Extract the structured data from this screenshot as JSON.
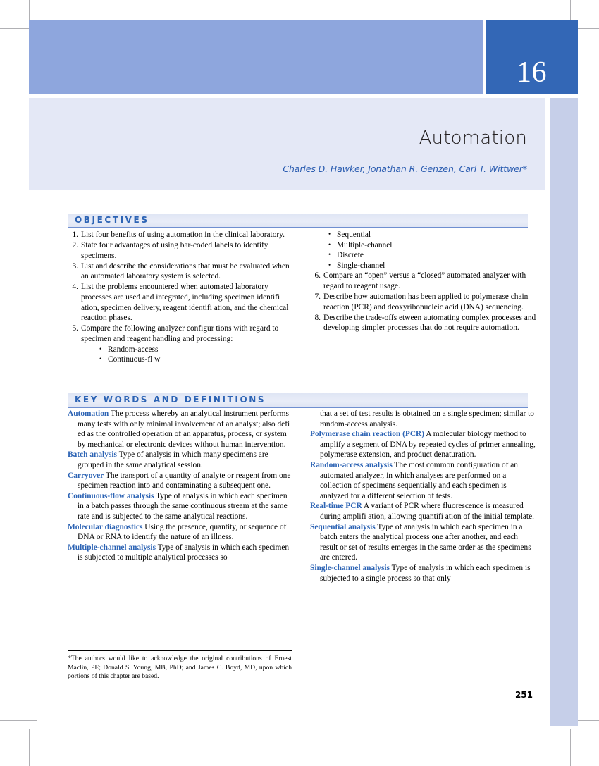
{
  "chapter": {
    "number": "16",
    "title": "Automation",
    "authors": "Charles D. Hawker, Jonathan R. Genzen, Carl T. Wittwer*"
  },
  "objectives": {
    "heading": "OBJECTIVES",
    "items_left": [
      {
        "num": "1.",
        "text": "List four benefits of using automation in the clinical laboratory."
      },
      {
        "num": "2.",
        "text": "State four advantages of using bar-coded labels to identify specimens."
      },
      {
        "num": "3.",
        "text": "List and describe the considerations that must be evaluated when an automated laboratory system is selected."
      },
      {
        "num": "4.",
        "text": "List the problems encountered when automated laboratory processes are used and integrated, including specimen identifi ation, specimen delivery, reagent identifi ation, and the chemical reaction phases."
      },
      {
        "num": "5.",
        "text": "Compare the following analyzer configur tions with regard to specimen and reagent handling and processing:"
      }
    ],
    "item5_bullets_left": [
      "Random-access",
      "Continuous-fl w"
    ],
    "item5_bullets_right": [
      "Sequential",
      "Multiple-channel",
      "Discrete",
      "Single-channel"
    ],
    "items_right": [
      {
        "num": "6.",
        "text": "Compare an “open” versus a “closed” automated analyzer with regard to reagent usage."
      },
      {
        "num": "7.",
        "text": "Describe how automation has been applied to polymerase chain reaction (PCR) and deoxyribonucleic acid (DNA) sequencing."
      },
      {
        "num": "8.",
        "text": "Describe the trade-offs  etween automating complex processes and developing simpler processes that do not require automation."
      }
    ]
  },
  "keywords": {
    "heading": "KEY WORDS AND DEFINITIONS",
    "entries_left": [
      {
        "term": "Automation",
        "definition": "The process whereby an analytical instrument performs many tests with only minimal involvement of an analyst; also defi ed as the controlled operation of an apparatus, process, or system by mechanical or electronic devices without human intervention."
      },
      {
        "term": "Batch analysis",
        "definition": "Type of analysis in which many specimens are grouped in the same analytical session."
      },
      {
        "term": "Carryover",
        "definition": "The transport of a quantity of analyte or reagent from one specimen reaction into and contaminating a subsequent one."
      },
      {
        "term": "Continuous-flow analysis",
        "definition": "Type of analysis in which each specimen in a batch passes through the same continuous stream at the same rate and is subjected to the same analytical reactions."
      },
      {
        "term": "Molecular diagnostics",
        "definition": "Using the presence, quantity, or sequence of DNA or RNA to identify the nature of an illness."
      },
      {
        "term": "Multiple-channel analysis",
        "definition": "Type of analysis in which each specimen is subjected to multiple analytical processes so"
      }
    ],
    "continuation_right": "that a set of test results is obtained on a single specimen; similar to random-access analysis.",
    "entries_right": [
      {
        "term": "Polymerase chain reaction (PCR)",
        "definition": "A molecular biology method to amplify a segment of DNA by repeated cycles of primer annealing, polymerase extension, and product denaturation."
      },
      {
        "term": "Random-access analysis",
        "definition": "The most common configuration of an automated analyzer, in which analyses are performed on a collection of specimens sequentially and each specimen is analyzed for a different selection of tests."
      },
      {
        "term": "Real-time PCR",
        "definition": "A variant of PCR where fluorescence is measured during amplifi ation, allowing quantifi ation of the initial template."
      },
      {
        "term": "Sequential analysis",
        "definition": "Type of analysis in which each specimen in a batch enters the analytical process one after another, and each result or set of results emerges in the same order as the specimens are entered."
      },
      {
        "term": "Single-channel analysis",
        "definition": "Type of analysis in which each specimen is subjected to a single process so that only"
      }
    ]
  },
  "footnote": "*The authors would like to acknowledge the original contributions of Ernest Maclin, PE; Donald S. Young, MB, PhD; and James C. Boyd, MD, upon which portions of this chapter are based.",
  "page_number": "251",
  "colors": {
    "header_band": "#8ea6dd",
    "chapter_box": "#3367b6",
    "title_block": "#e4e8f6",
    "right_rail": "#c6cfe9",
    "accent_blue": "#2c63b4"
  }
}
